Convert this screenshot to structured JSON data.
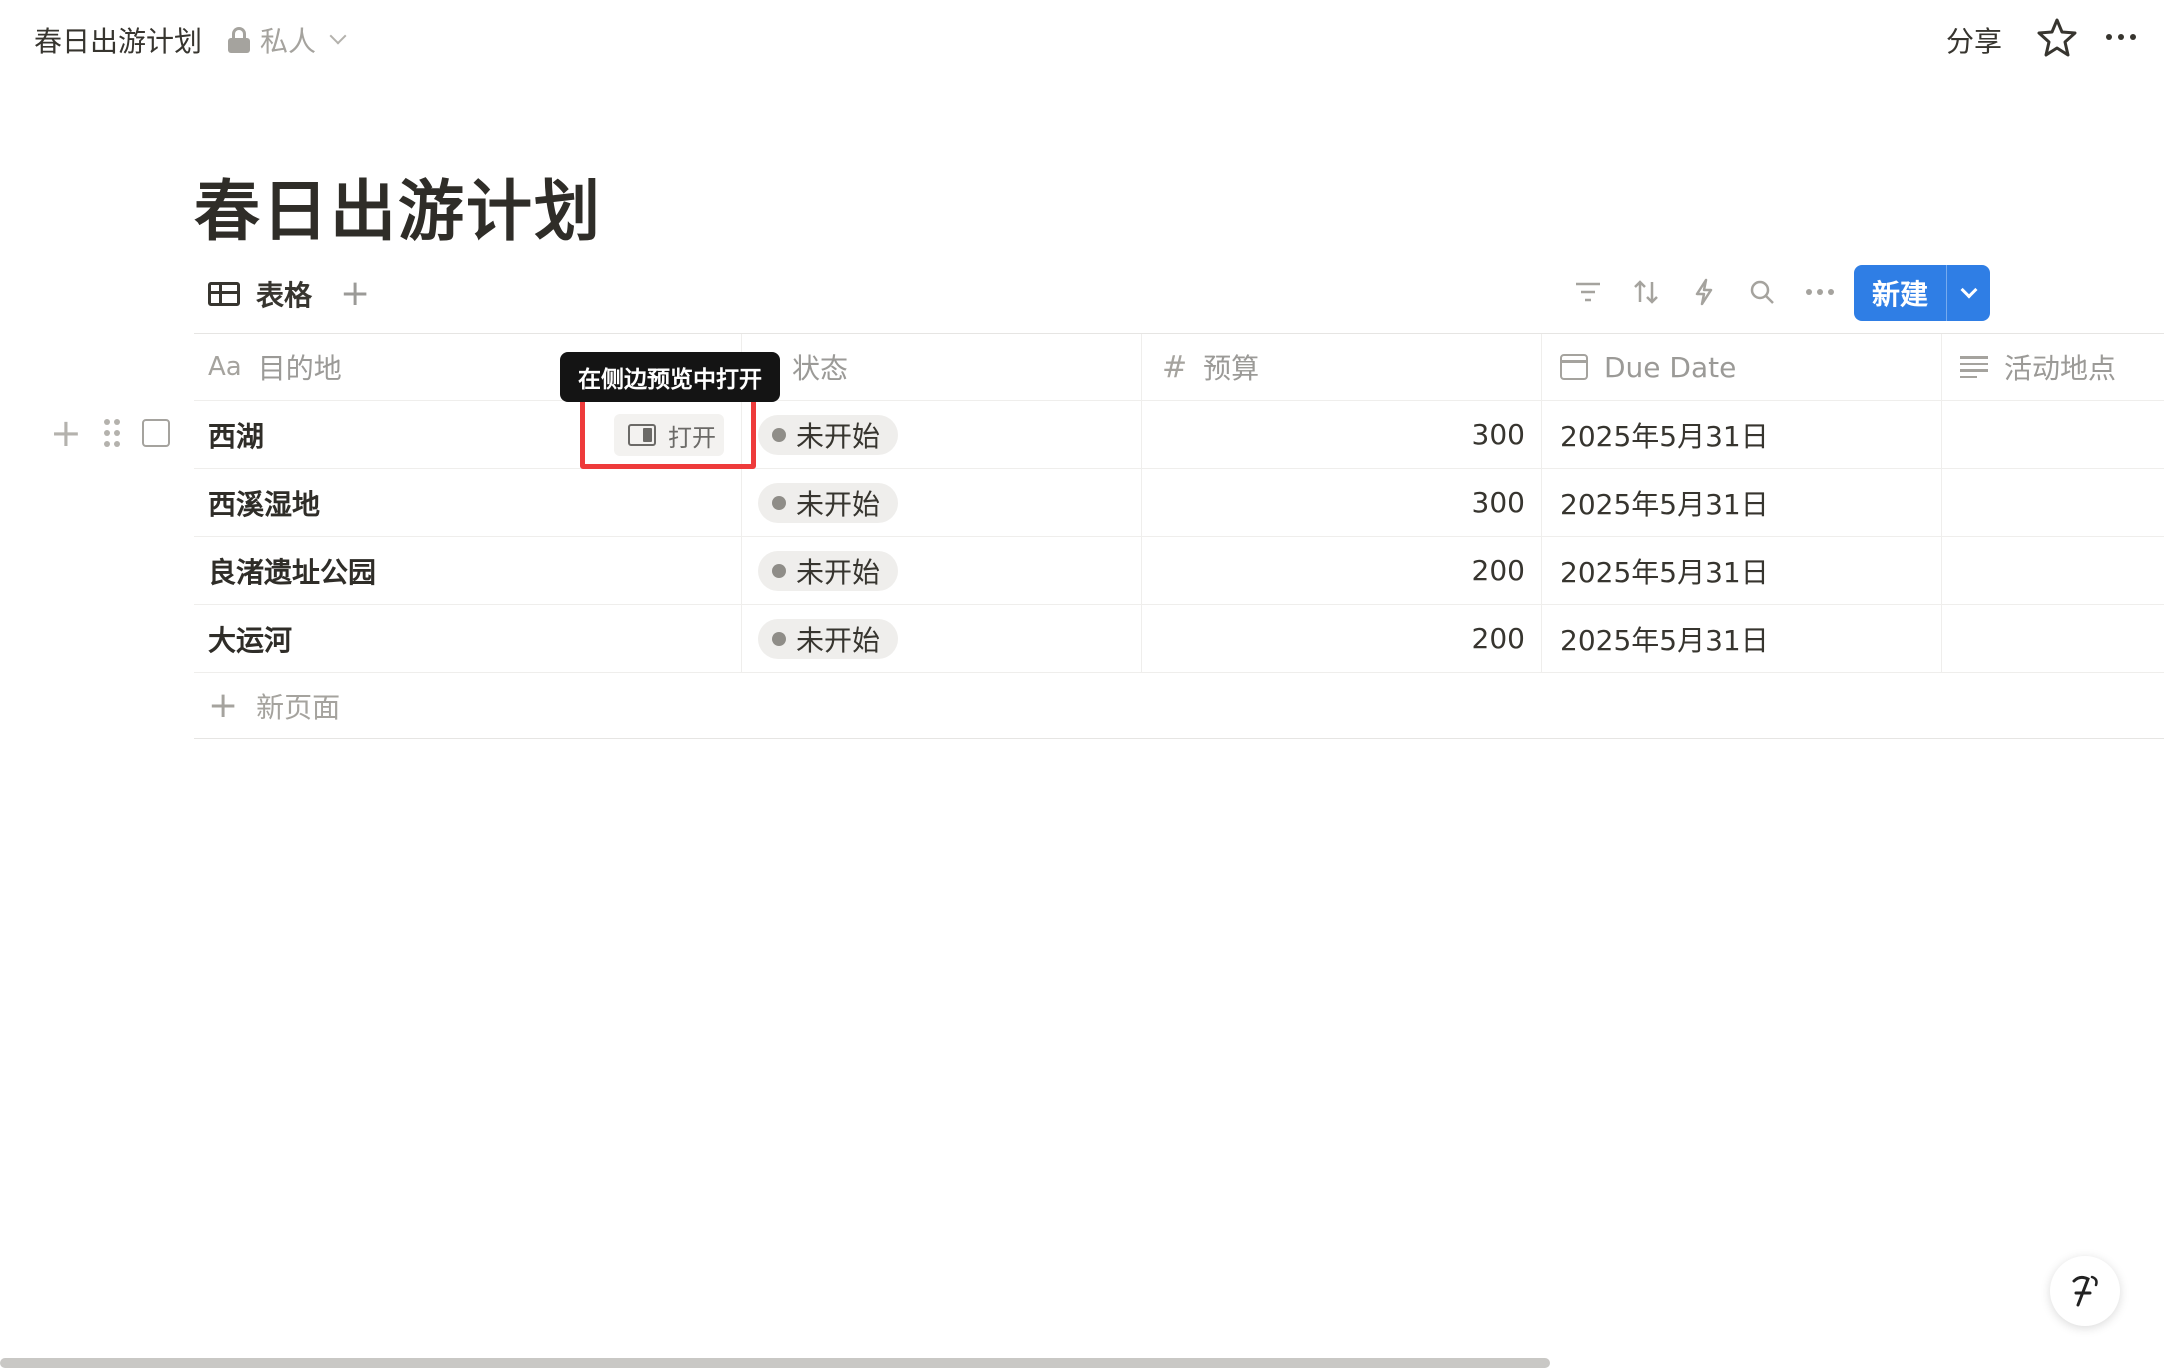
{
  "topbar": {
    "breadcrumb_title": "春日出游计划",
    "privacy_label": "私人",
    "share_label": "分享"
  },
  "page": {
    "title": "春日出游计划"
  },
  "view": {
    "tab_label": "表格",
    "new_button_label": "新建",
    "accent_color": "#2f7ee5"
  },
  "table": {
    "columns": [
      {
        "icon": "Aa",
        "label": "目的地"
      },
      {
        "icon": "status-icon",
        "label": "状态"
      },
      {
        "icon": "#",
        "label": "预算"
      },
      {
        "icon": "calendar-icon",
        "label": "Due Date"
      },
      {
        "icon": "text-lines-icon",
        "label": "活动地点"
      }
    ],
    "rows": [
      {
        "name": "西湖",
        "status": "未开始",
        "budget": "300",
        "due": "2025年5月31日",
        "place": ""
      },
      {
        "name": "西溪湿地",
        "status": "未开始",
        "budget": "300",
        "due": "2025年5月31日",
        "place": ""
      },
      {
        "name": "良渚遗址公园",
        "status": "未开始",
        "budget": "200",
        "due": "2025年5月31日",
        "place": ""
      },
      {
        "name": "大运河",
        "status": "未开始",
        "budget": "200",
        "due": "2025年5月31日",
        "place": ""
      }
    ],
    "open_button_label": "打开",
    "tooltip": "在侧边预览中打开",
    "new_page_label": "新页面"
  }
}
